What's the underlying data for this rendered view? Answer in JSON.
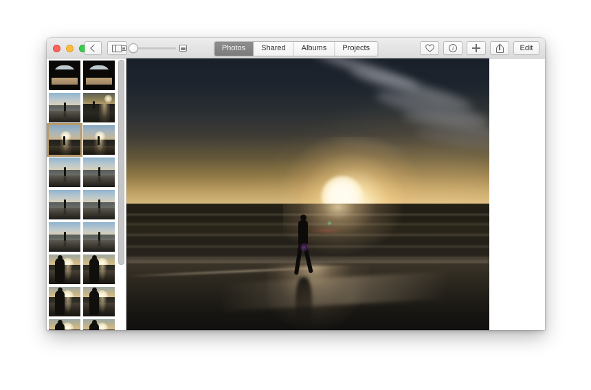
{
  "app": {
    "name": "Photos",
    "window_title": "Photos"
  },
  "titlebar": {
    "traffic_lights": [
      {
        "name": "close",
        "color": "#f9655b"
      },
      {
        "name": "minimize",
        "color": "#fdbc40"
      },
      {
        "name": "zoom",
        "color": "#35cd4b"
      }
    ],
    "back_button": {
      "icon": "chevron-left-icon",
      "label": ""
    },
    "sidebar_toggle": {
      "icon": "sidebar-toggle-icon",
      "label": ""
    }
  },
  "zoom_slider": {
    "left_icon": "small-thumbnail-icon",
    "right_icon": "large-thumbnail-icon",
    "value": 0,
    "min": 0,
    "max": 100
  },
  "segmented_control": {
    "selected": "Photos",
    "items": [
      {
        "label": "Photos",
        "selected": true
      },
      {
        "label": "Shared",
        "selected": false
      },
      {
        "label": "Albums",
        "selected": false
      },
      {
        "label": "Projects",
        "selected": false
      }
    ]
  },
  "toolbar_right": {
    "favorite": {
      "icon": "heart-icon",
      "label": ""
    },
    "info": {
      "icon": "info-icon",
      "label": "i"
    },
    "add": {
      "icon": "plus-icon",
      "label": ""
    },
    "share": {
      "icon": "share-icon",
      "label": ""
    },
    "edit": {
      "icon": "edit-button",
      "label": "Edit"
    }
  },
  "sidebar": {
    "scrollbar": {
      "name": "thumbnail-scrollbar",
      "position": "top"
    },
    "selected_index": 4,
    "thumbnails": [
      {
        "index": 0,
        "scene": "beach-through-arch",
        "type": "A",
        "selected": false
      },
      {
        "index": 1,
        "scene": "beach-through-arch",
        "type": "A",
        "selected": false
      },
      {
        "index": 2,
        "scene": "figure-on-bright-beach",
        "type": "B",
        "selected": false
      },
      {
        "index": 3,
        "scene": "sunset-glitter-sea",
        "type": "C",
        "selected": false
      },
      {
        "index": 4,
        "scene": "sunset-figure-sun",
        "type": "D",
        "selected": true
      },
      {
        "index": 5,
        "scene": "sunset-figure-sun",
        "type": "D",
        "selected": false
      },
      {
        "index": 6,
        "scene": "figure-on-bright-beach",
        "type": "B",
        "selected": false
      },
      {
        "index": 7,
        "scene": "figure-on-bright-beach",
        "type": "B",
        "selected": false
      },
      {
        "index": 8,
        "scene": "figure-on-bright-beach",
        "type": "B",
        "selected": false
      },
      {
        "index": 9,
        "scene": "figure-on-bright-beach",
        "type": "B",
        "selected": false
      },
      {
        "index": 10,
        "scene": "figure-on-bright-beach",
        "type": "B",
        "selected": false
      },
      {
        "index": 11,
        "scene": "figure-on-bright-beach",
        "type": "B",
        "selected": false
      },
      {
        "index": 12,
        "scene": "person-backlit-sunset",
        "type": "E",
        "selected": false
      },
      {
        "index": 13,
        "scene": "person-backlit-sunset",
        "type": "E",
        "selected": false
      },
      {
        "index": 14,
        "scene": "person-backlit-sunset",
        "type": "E",
        "selected": false
      },
      {
        "index": 15,
        "scene": "person-backlit-sunset",
        "type": "E",
        "selected": false
      },
      {
        "index": 16,
        "scene": "person-backlit-sunset",
        "type": "E",
        "selected": false
      },
      {
        "index": 17,
        "scene": "person-backlit-sunset",
        "type": "E",
        "selected": false
      }
    ],
    "selection_color": "#b99a6b"
  },
  "main_photo": {
    "name": "selected-photo",
    "description": "Silhouetted person walking on a wet sand beach at sunset; sun low over the ocean with glitter path and reflection, dark blue sky with wispy clouds upper right",
    "alt": "Beach sunset with walking figure",
    "colors": {
      "sky_top": "#1a2029",
      "sky_horizon": "#d5b97e",
      "sea": "#262217",
      "sand": "#2e2920",
      "sun": "#fffdf4"
    }
  }
}
